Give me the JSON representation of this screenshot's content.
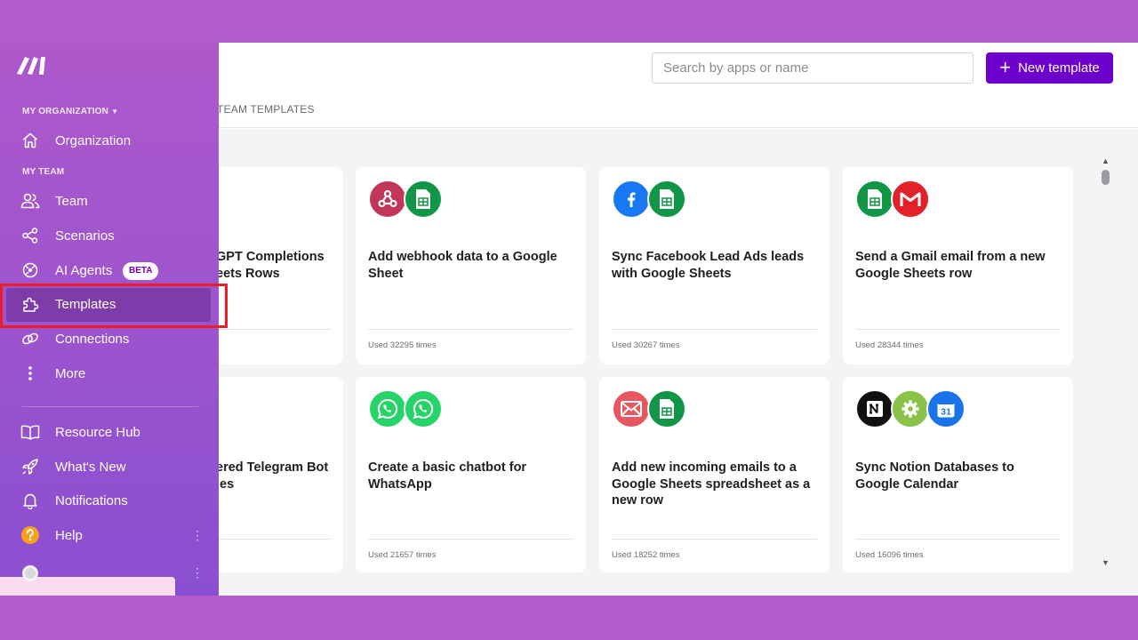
{
  "header": {
    "search_placeholder": "Search by apps or name",
    "new_template_label": "New template",
    "team_tab_label": "TEAM TEMPLATES"
  },
  "sidebar": {
    "org_section": "MY ORGANIZATION",
    "team_section": "MY TEAM",
    "organization": "Organization",
    "team": "Team",
    "scenarios": "Scenarios",
    "ai_agents": "AI Agents",
    "beta": "BETA",
    "templates": "Templates",
    "connections": "Connections",
    "more": "More",
    "resource_hub": "Resource Hub",
    "whats_new": "What's New",
    "notifications": "Notifications",
    "help": "Help"
  },
  "cards": [
    {
      "title": "GPT Completions\neets Rows",
      "used": ""
    },
    {
      "title": "Add webhook data to a Google Sheet",
      "used": "Used 32295 times"
    },
    {
      "title": "Sync Facebook Lead Ads leads with Google Sheets",
      "used": "Used 30267 times"
    },
    {
      "title": "Send a Gmail email from a new Google Sheets row",
      "used": "Used 28344 times"
    },
    {
      "title": "ered Telegram Bot\nies",
      "used": ""
    },
    {
      "title": "Create a basic chatbot for WhatsApp",
      "used": "Used 21657 times"
    },
    {
      "title": "Add new incoming emails to a Google Sheets spreadsheet as a new row",
      "used": "Used 18252 times"
    },
    {
      "title": "Sync Notion Databases to Google Calendar",
      "used": "Used 16096 times"
    }
  ],
  "icons": {
    "calendar_day": "31"
  },
  "colors": {
    "accent": "#6d00cc",
    "sidebar_top": "#ad58cb",
    "sidebar_bottom": "#8a4fd0",
    "highlight_box": "#ee1c24"
  }
}
